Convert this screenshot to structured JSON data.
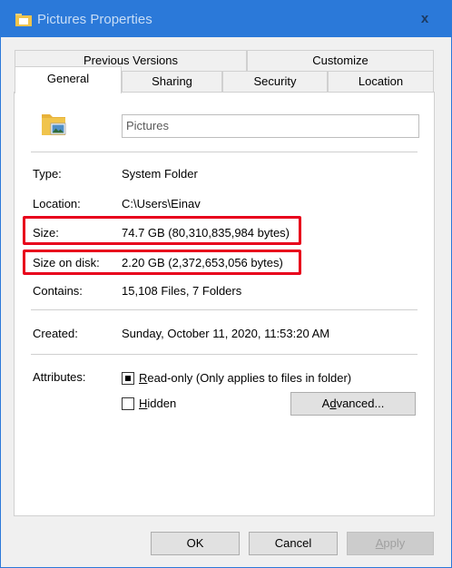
{
  "window": {
    "title": "Pictures Properties",
    "close_glyph": "x"
  },
  "tabs": {
    "row1": [
      {
        "label": "Previous Versions"
      },
      {
        "label": "Customize"
      }
    ],
    "row2": [
      {
        "label": "General",
        "active": true
      },
      {
        "label": "Sharing"
      },
      {
        "label": "Security"
      },
      {
        "label": "Location"
      }
    ]
  },
  "general": {
    "name_value": "Pictures",
    "type_label": "Type:",
    "type_value": "System Folder",
    "location_label": "Location:",
    "location_value": "C:\\Users\\Einav",
    "size_label": "Size:",
    "size_value": "74.7 GB (80,310,835,984 bytes)",
    "size_on_disk_label": "Size on disk:",
    "size_on_disk_value": "2.20 GB (2,372,653,056 bytes)",
    "contains_label": "Contains:",
    "contains_value": "15,108 Files, 7 Folders",
    "created_label": "Created:",
    "created_value": "Sunday, October 11, 2020, 11:53:20 AM",
    "attributes_label": "Attributes:",
    "readonly": {
      "underlined": "R",
      "rest": "ead-only (Only applies to files in folder)",
      "checked": "indeterminate"
    },
    "hidden": {
      "underlined": "H",
      "rest": "idden",
      "checked": false
    },
    "advanced": {
      "before": "A",
      "underlined": "d",
      "after": "vanced..."
    }
  },
  "footer": {
    "ok_label": "OK",
    "cancel_label": "Cancel",
    "apply_underlined": "A",
    "apply_rest": "pply",
    "apply_disabled": true
  },
  "colors": {
    "titlebar": "#2b79d9",
    "highlight": "#e8001c",
    "folder": "#f0c44c"
  },
  "icons": [
    "folder-icon",
    "close-icon",
    "pictures-folder-icon"
  ]
}
